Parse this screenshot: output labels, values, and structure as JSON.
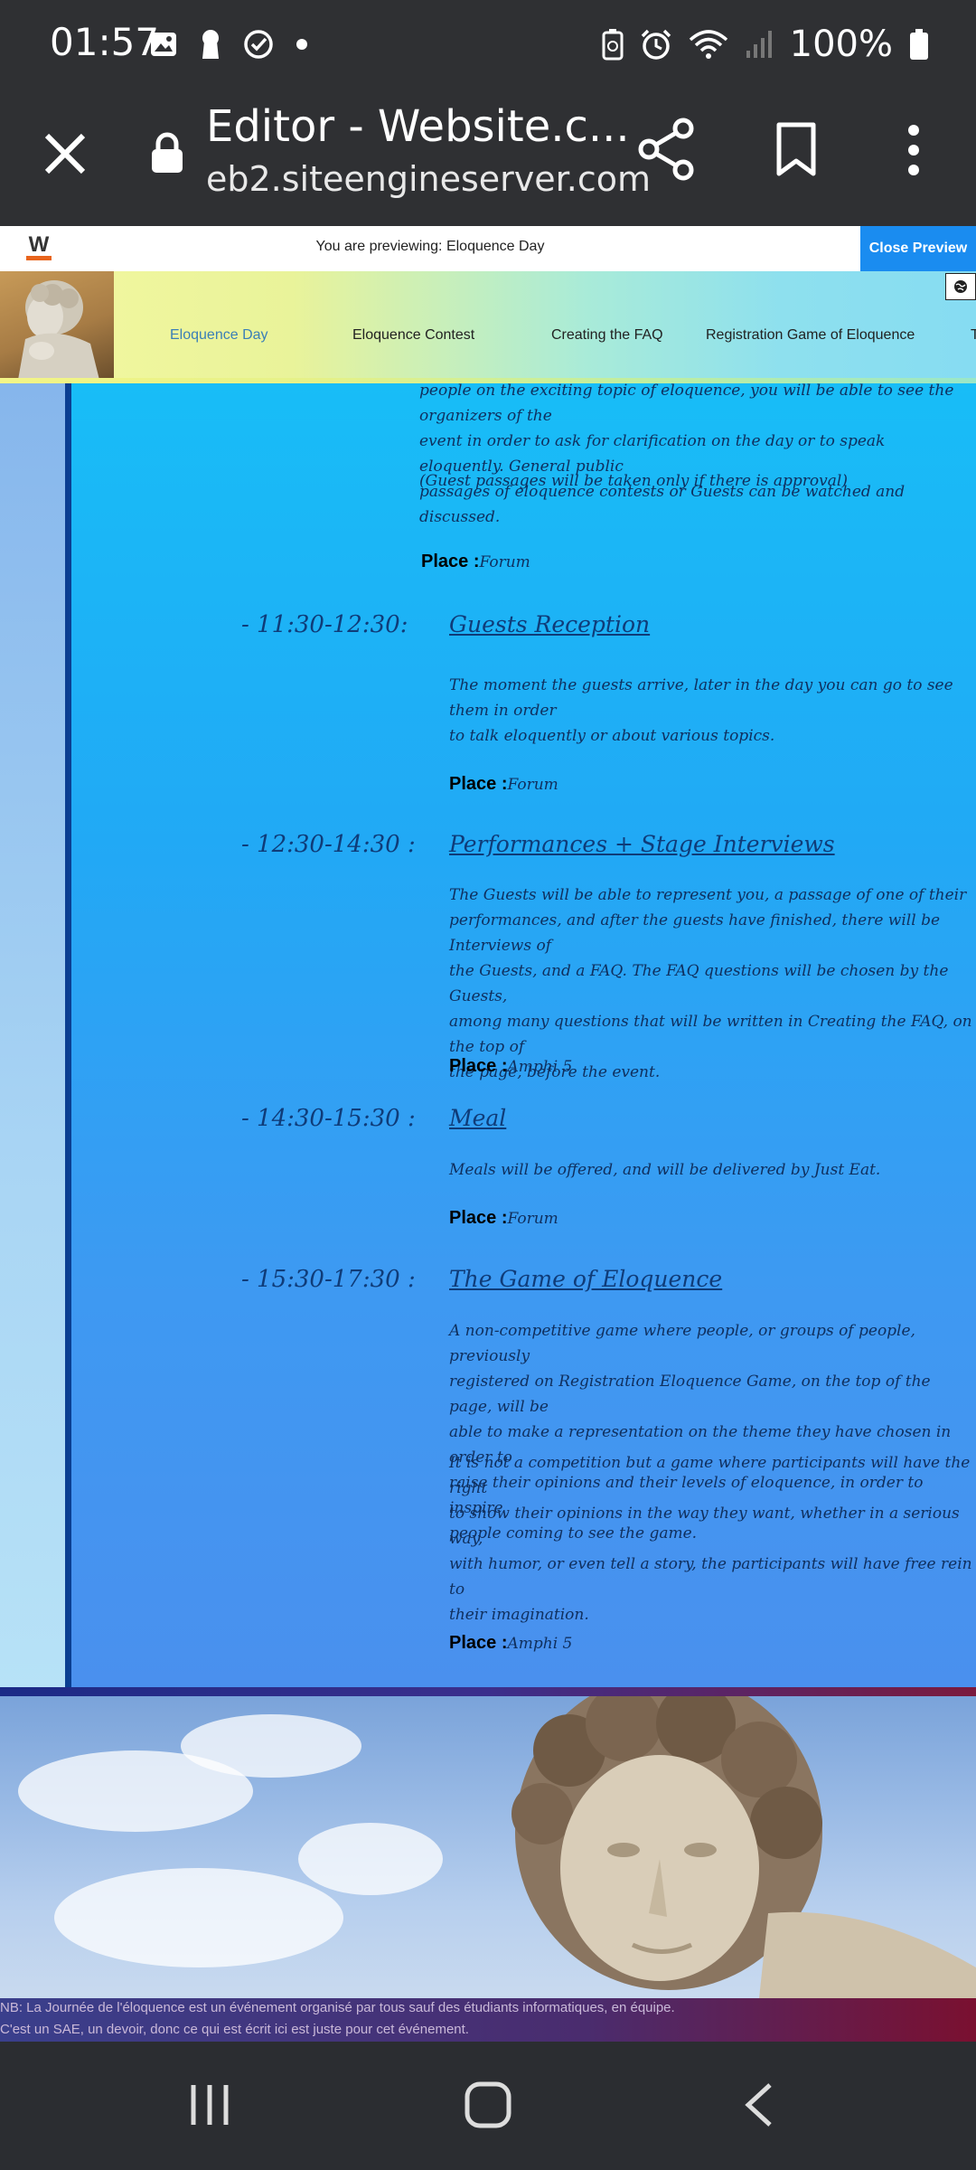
{
  "status_bar": {
    "time": "01:57",
    "battery_percent": "100%"
  },
  "browser": {
    "title": "Editor - Website.c...",
    "url": "eb2.siteengineserver.com"
  },
  "preview_bar": {
    "text": "You are previewing: Eloquence Day",
    "close_label": "Close Preview",
    "logo_letter": "W"
  },
  "nav": {
    "items": [
      {
        "label": "Eloquence Day",
        "active": true
      },
      {
        "label": "Eloquence Contest",
        "active": false
      },
      {
        "label": "Creating the FAQ",
        "active": false
      },
      {
        "label": "Registration Game of Eloquence",
        "active": false
      },
      {
        "label": "T",
        "active": false
      }
    ]
  },
  "content": {
    "intro_lines": [
      "people on the exciting topic of eloquence, you will be able to see the organizers of the",
      "event in order to ask for clarification on the day or to speak eloquently. General public",
      "passages of eloquence contests or Guests can be watched and discussed."
    ],
    "intro_note": "(Guest passages will be taken only if there is approval)",
    "place_label": "Place :",
    "first_place": "Forum",
    "events": [
      {
        "time": "- 11:30-12:30:",
        "title": "Guests Reception",
        "paragraphs": [
          [
            "The moment the guests arrive, later in the day you can go to see them in order",
            "to talk eloquently or about various topics."
          ]
        ],
        "place": "Forum"
      },
      {
        "time": "- 12:30-14:30 :",
        "title": "Performances + Stage Interviews",
        "paragraphs": [
          [
            "The Guests will be able to represent you, a passage of one of their",
            "performances, and after the guests have finished, there will be Interviews of",
            "the Guests, and a FAQ. The FAQ questions will be chosen by the Guests,",
            "among many questions that will be written in Creating the FAQ, on the top of",
            "the page, before the event."
          ]
        ],
        "place": "Amphi 5"
      },
      {
        "time": "- 14:30-15:30 :",
        "title": "Meal",
        "paragraphs": [
          [
            "Meals will be offered, and will be delivered by Just Eat."
          ]
        ],
        "place": "Forum"
      },
      {
        "time": "- 15:30-17:30 :",
        "title": "The Game of Eloquence",
        "paragraphs": [
          [
            "A non-competitive game where people, or groups of people, previously",
            "registered on Registration Eloquence Game, on the top of the page, will be",
            "able to make a representation on the theme they have chosen in order to",
            "raise their opinions and their levels of eloquence, in order to inspire",
            "people coming to see the game."
          ],
          [
            "It is not a competition but a game where participants will have the right",
            "to show their opinions in the way they want, whether in a serious way,",
            "with humor, or even tell a story, the participants will have free rein to",
            "their imagination."
          ]
        ],
        "place": "Amphi 5"
      }
    ]
  },
  "footer": {
    "lines": [
      "NB: La Journée de l'éloquence est un événement organisé par tous sauf des étudiants informatiques, en équipe.",
      "C'est un SAE, un devoir, donc ce qui est écrit ici est juste pour cet événement."
    ]
  },
  "icons": {
    "status_left": [
      "image-icon",
      "keyhole-icon",
      "check-circle-icon",
      "dot-icon"
    ],
    "status_right": [
      "battery-saver-icon",
      "alarm-icon",
      "wifi-icon",
      "signal-icon",
      "battery-icon"
    ],
    "toolbar": [
      "close-icon",
      "lock-icon",
      "share-icon",
      "bookmark-icon",
      "more-vert-icon"
    ],
    "android_nav": [
      "recents-icon",
      "home-icon",
      "back-icon"
    ]
  },
  "colors": {
    "accent": "#1a8cf0",
    "panel_top": "#18bdf7",
    "panel_bottom": "#4a90ee",
    "text_script": "#0f3c79"
  }
}
